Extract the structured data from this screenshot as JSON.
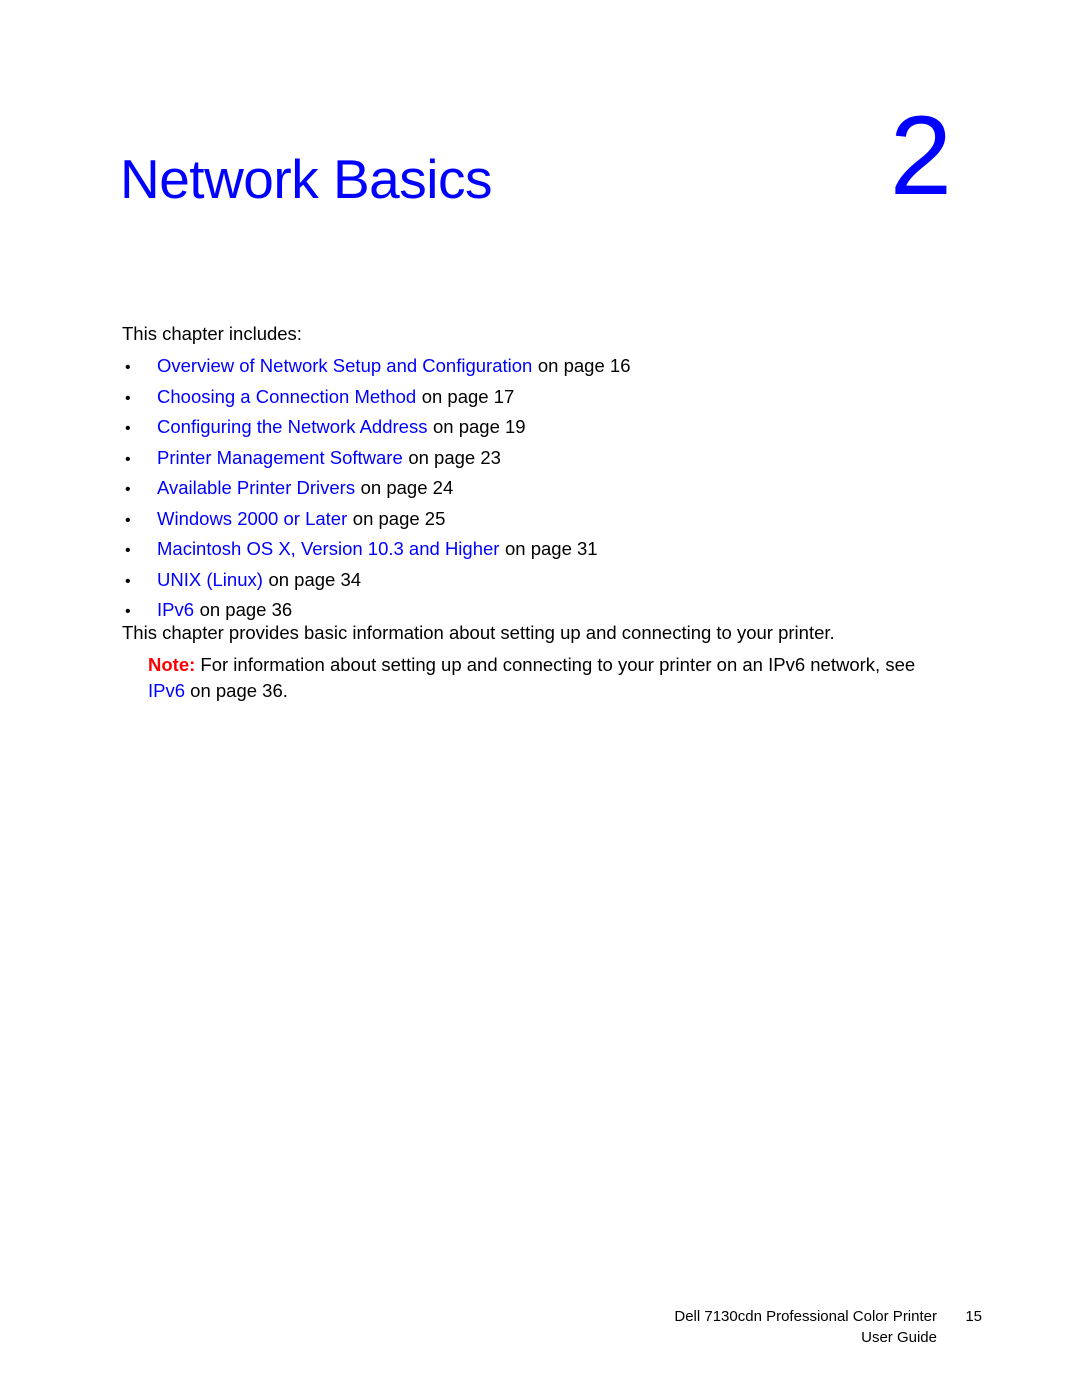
{
  "chapter": {
    "title": "Network Basics",
    "number": "2"
  },
  "intro_text": "This chapter includes:",
  "toc": {
    "bullet_glyph": "•",
    "items": [
      {
        "link": "Overview of Network Setup and Configuration",
        "tail": "on page 16"
      },
      {
        "link": "Choosing a Connection Method",
        "tail": "on page 17"
      },
      {
        "link": "Configuring the Network Address",
        "tail": "on page 19"
      },
      {
        "link": "Printer Management Software",
        "tail": "on page 23"
      },
      {
        "link": "Available Printer Drivers",
        "tail": "on page 24"
      },
      {
        "link": "Windows 2000 or Later",
        "tail": "on page 25"
      },
      {
        "link": "Macintosh OS X, Version 10.3 and Higher",
        "tail": "on page 31"
      },
      {
        "link": "UNIX (Linux)",
        "tail": "on page 34"
      },
      {
        "link": "IPv6",
        "tail": "on page 36"
      }
    ]
  },
  "body_paragraph": "This chapter provides basic information about setting up and connecting to your printer.",
  "note": {
    "label": "Note:",
    "text_before_link": "For information about setting up and connecting to your printer on an IPv6 network, see",
    "link": "IPv6",
    "text_after_link": "on page 36."
  },
  "footer": {
    "document": "Dell 7130cdn Professional Color Printer",
    "guide": "User Guide",
    "page_number": "15"
  },
  "colors": {
    "link_blue": "#0000ff",
    "note_red": "#ff0000",
    "text_black": "#000000",
    "page_background": "#ffffff"
  }
}
